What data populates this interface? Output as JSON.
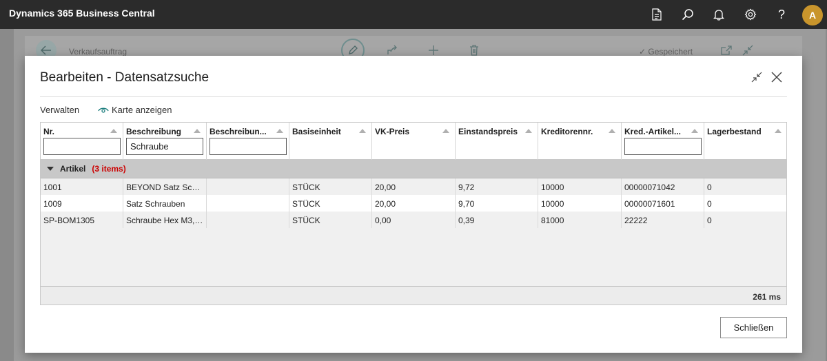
{
  "app": {
    "title": "Dynamics 365 Business Central",
    "avatar_initial": "A",
    "avatar_color": "#c9952c"
  },
  "topbar_icons": [
    "document-icon",
    "search-icon",
    "bell-icon",
    "gear-icon",
    "help-icon"
  ],
  "background_page": {
    "title": "Verkaufsauftrag",
    "saved_label": "Gespeichert"
  },
  "dialog": {
    "title": "Bearbeiten - Datensatzsuche",
    "actions": {
      "manage": "Verwalten",
      "show_card": "Karte anzeigen"
    },
    "close_button": "Schließen",
    "timing": "261 ms"
  },
  "table": {
    "columns": [
      {
        "label": "Nr.",
        "filter": ""
      },
      {
        "label": "Beschreibung",
        "filter": "Schraube"
      },
      {
        "label": "Beschreibun...",
        "filter": ""
      },
      {
        "label": "Basiseinheit"
      },
      {
        "label": "VK-Preis"
      },
      {
        "label": "Einstandspreis"
      },
      {
        "label": "Kreditorennr."
      },
      {
        "label": "Kred.-Artikel...",
        "filter": ""
      },
      {
        "label": "Lagerbestand"
      }
    ],
    "group": {
      "name": "Artikel",
      "count": "(3 items)"
    },
    "rows": [
      [
        "1001",
        "BEYOND Satz Schr...",
        "",
        "STÜCK",
        "20,00",
        "9,72",
        "10000",
        "00000071042",
        "0"
      ],
      [
        "1009",
        "Satz Schrauben",
        "",
        "STÜCK",
        "20,00",
        "9,70",
        "10000",
        "00000071601",
        "0"
      ],
      [
        "SP-BOM1305",
        "Schraube Hex M3, ...",
        "",
        "STÜCK",
        "0,00",
        "0,39",
        "81000",
        "22222",
        "0"
      ]
    ]
  },
  "colors": {
    "accent": "#1f7f7f",
    "group_count": "#cc0000",
    "appbar": "#2b2b2b"
  }
}
